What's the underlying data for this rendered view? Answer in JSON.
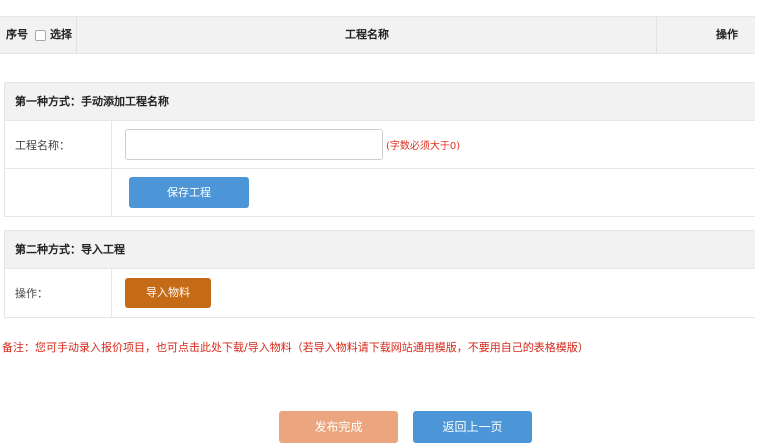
{
  "list_header": {
    "col_index": "序号",
    "col_select": "选择",
    "col_name": "工程名称",
    "col_action": "操作"
  },
  "section_manual": {
    "title": "第一种方式：手动添加工程名称",
    "name_label": "工程名称：",
    "name_value": "",
    "name_hint": "(字数必须大于0)",
    "save_button": "保存工程"
  },
  "section_import": {
    "title": "第二种方式：导入工程",
    "action_label": "操作：",
    "import_button": "导入物料"
  },
  "note": "备注：您可手动录入报价项目，也可点击此处下载/导入物料（若导入物料请下载网站通用模版，不要用自己的表格模版）",
  "footer": {
    "publish_button": "发布完成",
    "back_button": "返回上一页"
  },
  "colors": {
    "blue": "#4c96d7",
    "orange": "#c56a16",
    "peach": "#eba67f",
    "red": "#d6291c",
    "header_bg": "#f2f2f2"
  }
}
